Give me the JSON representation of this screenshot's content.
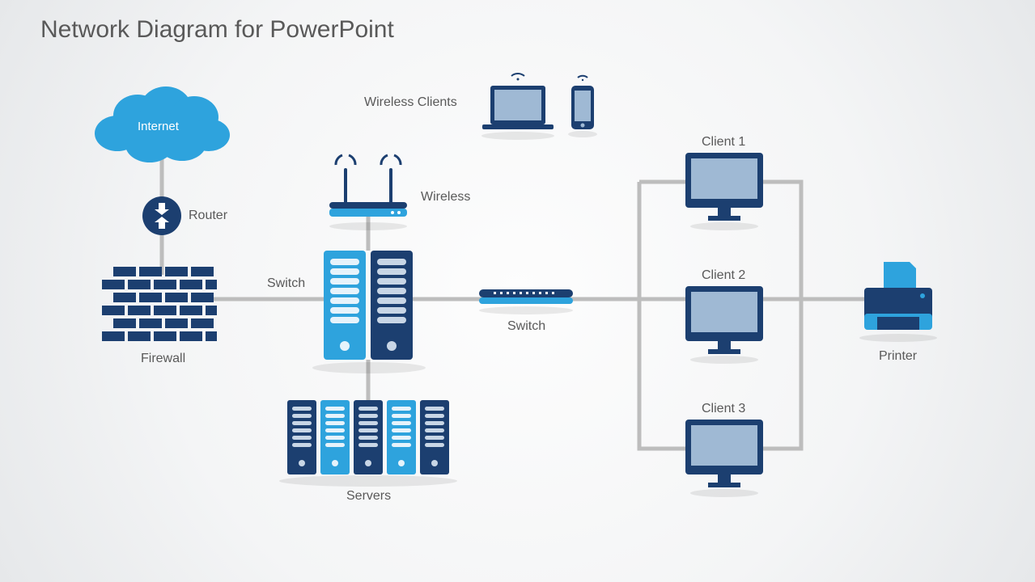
{
  "title": "Network Diagram for PowerPoint",
  "labels": {
    "internet": "Internet",
    "router": "Router",
    "firewall": "Firewall",
    "wirelessClients": "Wireless Clients",
    "wireless": "Wireless",
    "switch1": "Switch",
    "switch2": "Switch",
    "servers": "Servers",
    "client1": "Client 1",
    "client2": "Client 2",
    "client3": "Client 3",
    "printer": "Printer"
  },
  "colors": {
    "light": "#2EA3DD",
    "dark": "#1C3F70",
    "mutedBlue": "#9FB9D4",
    "line": "#BDBDBD",
    "white": "#FFFFFF"
  },
  "diagram": {
    "nodes": [
      "Internet",
      "Router",
      "Firewall",
      "Wireless",
      "Wireless Clients",
      "Switch",
      "Servers",
      "Switch",
      "Client 1",
      "Client 2",
      "Client 3",
      "Printer"
    ],
    "edges": [
      [
        "Internet",
        "Router"
      ],
      [
        "Router",
        "Firewall"
      ],
      [
        "Firewall",
        "Switch"
      ],
      [
        "Switch",
        "Wireless"
      ],
      [
        "Wireless",
        "Wireless Clients"
      ],
      [
        "Switch",
        "Servers"
      ],
      [
        "Switch",
        "Switch"
      ],
      [
        "Switch",
        "Client 1"
      ],
      [
        "Switch",
        "Client 2"
      ],
      [
        "Switch",
        "Client 3"
      ],
      [
        "Switch",
        "Printer"
      ]
    ]
  }
}
